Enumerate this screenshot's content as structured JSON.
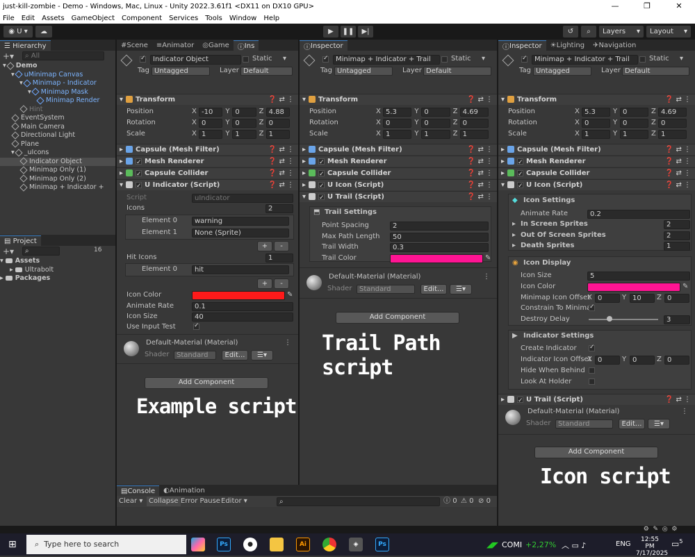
{
  "window": {
    "title": "just-kill-zombie - Demo - Windows, Mac, Linux - Unity 2022.3.61f1 <DX11 on DX10 GPU>",
    "min": "—",
    "max": "❐",
    "close": "✕"
  },
  "menu": [
    "File",
    "Edit",
    "Assets",
    "GameObject",
    "Component",
    "Services",
    "Tools",
    "Window",
    "Help"
  ],
  "toolbar": {
    "account": "U",
    "layers": "Layers",
    "layout": "Layout"
  },
  "hierarchy": {
    "tab": "Hierarchy",
    "search": "All",
    "items": [
      {
        "label": "Demo",
        "indent": 0,
        "style": "bold"
      },
      {
        "label": "uMinimap Canvas",
        "indent": 1,
        "style": "blue"
      },
      {
        "label": "Minimap - Indicator",
        "indent": 2,
        "style": "blue"
      },
      {
        "label": "Minimap Mask",
        "indent": 3,
        "style": "blue"
      },
      {
        "label": "Minimap Render",
        "indent": 4,
        "style": "blue"
      },
      {
        "label": "Hint",
        "indent": 2,
        "style": "dim"
      },
      {
        "label": "EventSystem",
        "indent": 1,
        "style": ""
      },
      {
        "label": "Main Camera",
        "indent": 1,
        "style": ""
      },
      {
        "label": "Directional Light",
        "indent": 1,
        "style": ""
      },
      {
        "label": "Plane",
        "indent": 1,
        "style": ""
      },
      {
        "label": "_uIcons",
        "indent": 1,
        "style": ""
      },
      {
        "label": "Indicator Object",
        "indent": 2,
        "style": "sel"
      },
      {
        "label": "Minimap Only (1)",
        "indent": 2,
        "style": ""
      },
      {
        "label": "Minimap Only (2)",
        "indent": 2,
        "style": ""
      },
      {
        "label": "Minimap + Indicator +",
        "indent": 2,
        "style": ""
      }
    ]
  },
  "project": {
    "tab": "Project",
    "badge": "16",
    "items": [
      "Assets",
      "Ultrabolt",
      "Packages"
    ]
  },
  "scene_tabs": [
    "Scene",
    "Animator",
    "Game",
    "Ins"
  ],
  "common": {
    "tag": "Tag",
    "untagged": "Untagged",
    "layer": "Layer",
    "default": "Default",
    "static": "Static",
    "transform": "Transform",
    "position": "Position",
    "rotation": "Rotation",
    "scale": "Scale",
    "x": "X",
    "y": "Y",
    "z": "Z",
    "mesh_filter": "Capsule (Mesh Filter)",
    "mesh_renderer": "Mesh Renderer",
    "capsule_collider": "Capsule Collider",
    "material": "Default-Material (Material)",
    "shader": "Shader",
    "standard": "Standard",
    "edit": "Edit...",
    "add_component": "Add Component",
    "plus": "+",
    "minus": "-"
  },
  "col1": {
    "name": "Indicator Object",
    "pos": [
      "-10",
      "0",
      "4.88"
    ],
    "rot": [
      "0",
      "0",
      "0"
    ],
    "scale": [
      "1",
      "1",
      "1"
    ],
    "script_header": "U Indicator (Script)",
    "script_label": "Script",
    "script_value": "uIndicator",
    "icons_label": "Icons",
    "icons_count": "2",
    "elem0": "Element 0",
    "elem0_val": "warning",
    "elem1": "Element 1",
    "elem1_val": "None (Sprite)",
    "hit_icons": "Hit Icons",
    "hit_count": "1",
    "hit_elem0_val": "hit",
    "icon_color": "Icon Color",
    "animate_rate": "Animate Rate",
    "animate_val": "0.1",
    "icon_size": "Icon Size",
    "icon_size_val": "40",
    "use_input": "Use Input Test",
    "overlay": "Example script"
  },
  "col2": {
    "tab": "Inspector",
    "name": "Minimap + Indicator + Trail",
    "pos": [
      "5.3",
      "0",
      "4.69"
    ],
    "rot": [
      "0",
      "0",
      "0"
    ],
    "scale": [
      "1",
      "1",
      "1"
    ],
    "uicon": "U Icon (Script)",
    "utrail": "U Trail (Script)",
    "trail_settings": "Trail Settings",
    "point_spacing": "Point Spacing",
    "point_val": "2",
    "max_path": "Max Path Length",
    "max_val": "50",
    "trail_width": "Trail Width",
    "width_val": "0.3",
    "trail_color": "Trail Color",
    "overlay": "Trail Path script"
  },
  "col3": {
    "tabs": [
      "Inspector",
      "Lighting",
      "Navigation"
    ],
    "name": "Minimap + Indicator + Trail",
    "pos": [
      "5.3",
      "0",
      "4.69"
    ],
    "rot": [
      "0",
      "0",
      "0"
    ],
    "scale": [
      "1",
      "1",
      "1"
    ],
    "uicon": "U Icon (Script)",
    "icon_settings": "Icon Settings",
    "animate_rate": "Animate Rate",
    "animate_val": "0.2",
    "in_screen": "In Screen Sprites",
    "in_val": "2",
    "out_screen": "Out Of Screen Sprites",
    "out_val": "2",
    "death": "Death Sprites",
    "death_val": "1",
    "icon_display": "Icon Display",
    "icon_size": "Icon Size",
    "icon_size_val": "5",
    "icon_color": "Icon Color",
    "minimap_offset": "Minimap Icon Offset",
    "mo": [
      "0",
      "10",
      "0"
    ],
    "constrain": "Constrain To Minimap",
    "destroy": "Destroy Delay",
    "destroy_val": "3",
    "destroy_frac": 0.3,
    "indicator_settings": "Indicator Settings",
    "create": "Create Indicator",
    "ind_offset": "Indicator Icon Offset",
    "io": [
      "0",
      "0",
      "0"
    ],
    "hide": "Hide When Behind",
    "look": "Look At Holder",
    "utrail": "U Trail (Script)",
    "overlay": "Icon script"
  },
  "console": {
    "tabs": [
      "Console",
      "Animation"
    ],
    "clear": "Clear",
    "collapse": "Collapse",
    "error_pause": "Error Pause",
    "editor": "Editor",
    "c0": "0",
    "c1": "0",
    "c2": "0"
  },
  "taskbar": {
    "search": "Type here to search",
    "stock": "COMI",
    "stock_change": "+2,27%",
    "lang": "ENG",
    "time": "12:55 PM",
    "date": "7/17/2025",
    "notif": "5"
  },
  "colors": {
    "icon_color": "#ff1a1a",
    "trail_color": "#ff1493",
    "uicon_color": "#ff1493"
  }
}
